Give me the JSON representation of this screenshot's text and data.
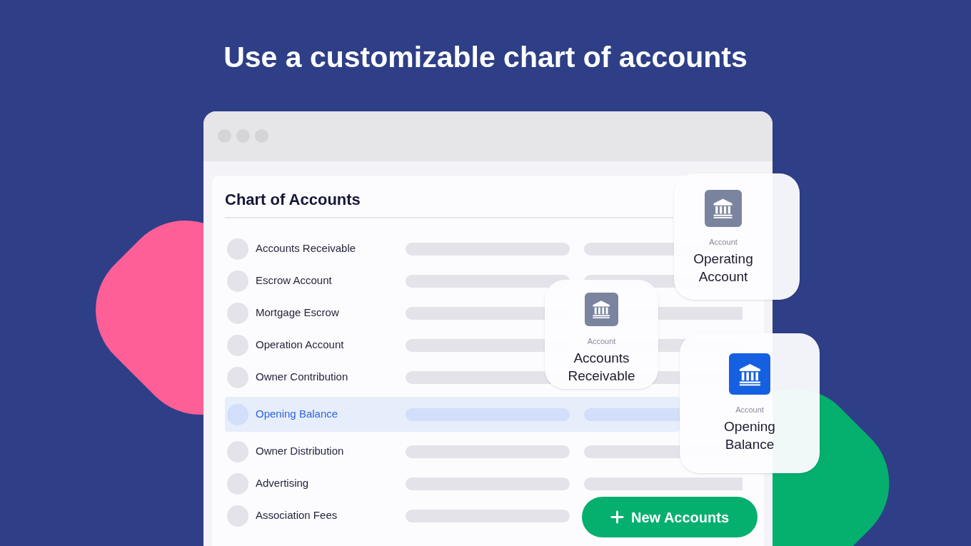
{
  "heading": "Use a customizable chart of accounts",
  "panel": {
    "title": "Chart of Accounts",
    "rows": [
      {
        "label": "Accounts Receivable",
        "selected": false
      },
      {
        "label": "Escrow Account",
        "selected": false
      },
      {
        "label": "Mortgage Escrow",
        "selected": false
      },
      {
        "label": "Operation Account",
        "selected": false
      },
      {
        "label": "Owner Contribution",
        "selected": false
      },
      {
        "label": "Opening Balance",
        "selected": true
      },
      {
        "label": "Owner Distribution",
        "selected": false
      },
      {
        "label": "Advertising",
        "selected": false
      },
      {
        "label": "Association Fees",
        "selected": false
      }
    ]
  },
  "account_cards": [
    {
      "caption": "Account",
      "title": "Operating Account",
      "selected": false
    },
    {
      "caption": "Account",
      "title": "Accounts Receivable",
      "selected": false
    },
    {
      "caption": "Account",
      "title": "Opening Balance",
      "selected": true
    }
  ],
  "button": {
    "label": "New Accounts"
  }
}
